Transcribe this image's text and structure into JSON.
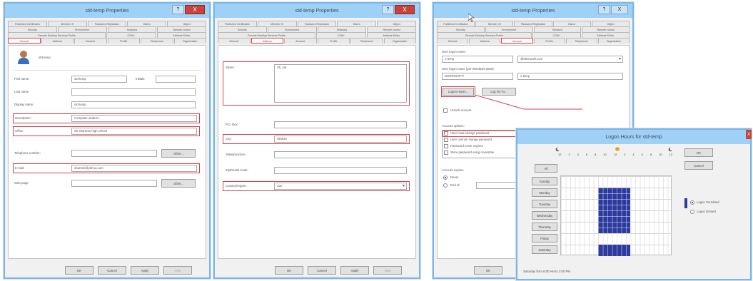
{
  "colors": {
    "accent": "#d8434a",
    "title_bar": "#9fd0f5",
    "close": "#c9433a",
    "logon_cell": "#2b3a9e"
  },
  "panel1": {
    "title": "std-temp Properties",
    "help": "?",
    "close": "X",
    "tabs_row1": [
      "Published Certificates",
      "Member Of",
      "Password Replication",
      "Dial-in",
      "Object"
    ],
    "tabs_row2": [
      "Security",
      "Environment",
      "Sessions",
      "Remote control"
    ],
    "tabs_row3": [
      "Remote Desktop Services Profile",
      "COM+",
      "Attribute Editor"
    ],
    "tabs_row4": [
      "General",
      "Address",
      "Account",
      "Profile",
      "Telephones",
      "Organization"
    ],
    "user_name": "std-temp",
    "fields": [
      {
        "label": "First name:",
        "value": "std-temp"
      },
      {
        "label": "Last name:",
        "value": ""
      },
      {
        "label": "Display name:",
        "value": "std-temp"
      },
      {
        "label": "Description:",
        "value": "Computer student"
      },
      {
        "label": "Office:",
        "value": "Sh.shamran high school"
      },
      {
        "label": "Telephone number:",
        "value": ""
      },
      {
        "label": "E-mail:",
        "value": "sharmin@yahoo.com"
      },
      {
        "label": "Web page:",
        "value": ""
      }
    ],
    "initials_label": "Initials:",
    "other_label": "Other...",
    "buttons": [
      "OK",
      "Cancel",
      "Apply",
      "Help"
    ]
  },
  "panel2": {
    "title": "std-temp Properties",
    "help": "?",
    "close": "X",
    "tabs_row1": [
      "Published Certificates",
      "Member Of",
      "Password Replication",
      "Dial-in",
      "Object"
    ],
    "tabs_row2": [
      "Security",
      "Environment",
      "Sessions",
      "Remote control"
    ],
    "tabs_row3": [
      "Remote Desktop Services Profile",
      "COM+",
      "Attribute Editor"
    ],
    "tabs_row4": [
      "General",
      "Address",
      "Account",
      "Profile",
      "Telephones",
      "Organization"
    ],
    "street_label": "Street:",
    "street_value": "Sh_sar",
    "po_box_label": "P.O. Box:",
    "city_label": "City:",
    "city_value": "isfahan",
    "state_label": "State/province:",
    "zip_label": "Zip/Postal Code:",
    "country_label": "Country/region:",
    "country_value": "Iran",
    "buttons": [
      "OK",
      "Cancel",
      "Apply",
      "Help"
    ]
  },
  "panel3": {
    "title": "std-temp Properties",
    "help": "?",
    "close": "X",
    "tabs_row1": [
      "Published Certificates",
      "Member Of",
      "Password Replication",
      "Dial-in",
      "Object"
    ],
    "tabs_row2": [
      "Security",
      "Environment",
      "Sessions",
      "Remote control"
    ],
    "tabs_row3": [
      "Remote Desktop Services Profile",
      "COM+",
      "Attribute Editor"
    ],
    "tabs_row4": [
      "General",
      "Address",
      "Account",
      "Profile",
      "Telephones",
      "Organization"
    ],
    "logon_label": "User logon name:",
    "logon_value": "s-temp",
    "domain_value": "@Microsoft.com",
    "logon_pre2000_label": "User logon name (pre-Windows 2000):",
    "pre2000_domain": "MICROSOFT\\",
    "pre2000_user": "s-temp",
    "logon_hours_btn": "Logon Hours...",
    "logon_to_btn": "Log On To...",
    "unlock_label": "Unlock account",
    "account_options_label": "Account options:",
    "options": [
      "User must change password",
      "User cannot change password",
      "Password never expires",
      "Store password using reversible"
    ],
    "expires_label": "Account expires",
    "never_label": "Never",
    "endof_label": "End of:",
    "ok": "OK"
  },
  "dialog": {
    "title": "Logon Hours for std-temp",
    "close": "X",
    "hours": [
      "12",
      "2",
      "4",
      "6",
      "8",
      "10",
      "12",
      "2",
      "4",
      "6",
      "8",
      "10",
      "12"
    ],
    "all_label": "All",
    "days": [
      "Sunday",
      "Monday",
      "Tuesday",
      "Wednesday",
      "Thursday",
      "Friday",
      "Saturday"
    ],
    "ok": "OK",
    "cancel": "Cancel",
    "permitted": "Logon Permitted",
    "denied": "Logon Denied",
    "status": "Saturday from 8:00 AM to 2:00 PM"
  }
}
